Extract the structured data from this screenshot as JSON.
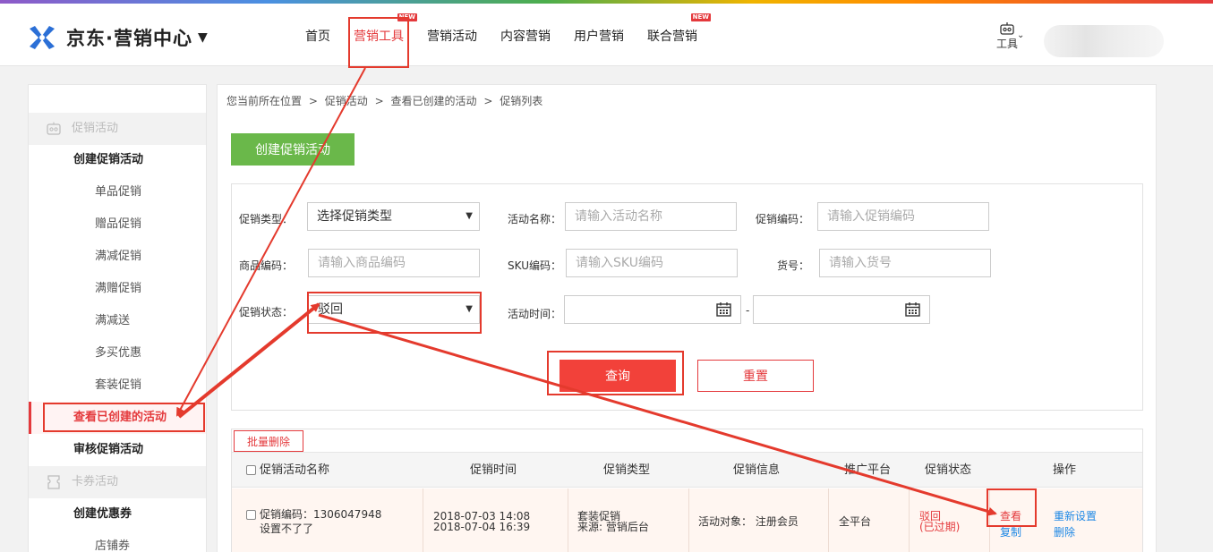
{
  "header": {
    "logo_text": "京东·营销中心",
    "logo_caret": "▼",
    "nav": [
      {
        "label": "首页",
        "badge": ""
      },
      {
        "label": "营销工具",
        "badge": "NEW",
        "active": true
      },
      {
        "label": "营销活动",
        "badge": ""
      },
      {
        "label": "内容营销",
        "badge": ""
      },
      {
        "label": "用户营销",
        "badge": ""
      },
      {
        "label": "联合营销",
        "badge": "NEW"
      }
    ],
    "tools_label": "工具",
    "tools_icon": "robot-icon"
  },
  "sidebar": {
    "groups": [
      {
        "label": "促销活动",
        "icon": "promo-icon"
      },
      {
        "label": "卡券活动",
        "icon": "coupon-icon"
      }
    ],
    "items": [
      {
        "label": "创建促销活动",
        "level": 1
      },
      {
        "label": "单品促销",
        "level": 2
      },
      {
        "label": "赠品促销",
        "level": 2
      },
      {
        "label": "满减促销",
        "level": 2
      },
      {
        "label": "满赠促销",
        "level": 2
      },
      {
        "label": "满减送",
        "level": 2
      },
      {
        "label": "多买优惠",
        "level": 2
      },
      {
        "label": "套装促销",
        "level": 2
      },
      {
        "label": "查看已创建的活动",
        "level": 1,
        "current": true
      },
      {
        "label": "审核促销活动",
        "level": 1
      },
      {
        "label": "创建优惠券",
        "level": 1
      },
      {
        "label": "店铺券",
        "level": 2
      }
    ]
  },
  "breadcrumb": {
    "prefix": "您当前所在位置",
    "items": [
      "促销活动",
      "查看已创建的活动",
      "促销列表"
    ],
    "separator": ">"
  },
  "create_button": "创建促销活动",
  "filters": {
    "promo_type": {
      "label": "促销类型：",
      "value": "选择促销类型"
    },
    "activity_name": {
      "label": "活动名称：",
      "placeholder": "请输入活动名称"
    },
    "promo_code": {
      "label": "促销编码：",
      "placeholder": "请输入促销编码"
    },
    "product_code": {
      "label": "商品编码：",
      "placeholder": "请输入商品编码"
    },
    "sku_code": {
      "label": "SKU编码：",
      "placeholder": "请输入SKU编码"
    },
    "item_no": {
      "label": "货号：",
      "placeholder": "请输入货号"
    },
    "promo_status": {
      "label": "促销状态：",
      "value": "驳回"
    },
    "activity_time": {
      "label": "活动时间：",
      "separator": "-"
    },
    "query_button": "查询",
    "reset_button": "重置"
  },
  "table": {
    "batch_delete": "批量删除",
    "headers": [
      "促销活动名称",
      "促销时间",
      "促销类型",
      "促销信息",
      "推广平台",
      "促销状态",
      "操作"
    ],
    "rows": [
      {
        "code_line": "促销编码：1306047948",
        "name": "设置不了了",
        "time_start": "2018-07-03 14:08",
        "time_end": "2018-07-04 16:39",
        "type": "套装促销",
        "source": "来源: 营销后台",
        "info": "活动对象： 注册会员",
        "platform": "全平台",
        "status": "驳回",
        "status_note": "(已过期)",
        "ops": [
          "查看",
          "复制",
          "重新设置",
          "删除"
        ]
      }
    ]
  },
  "colors": {
    "accent": "#e4393c",
    "create_button": "#6ab84a",
    "link": "#1e88e5",
    "annotation": "#e43a2d"
  }
}
